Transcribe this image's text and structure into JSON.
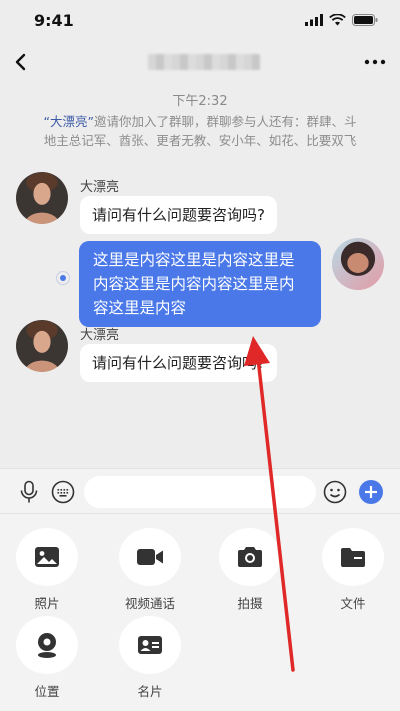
{
  "status_bar": {
    "time": "9:41"
  },
  "nav": {
    "back_label": "‹",
    "more_label": "···"
  },
  "chat": {
    "timestamp": "下午2:32",
    "system_message": {
      "inviter": "“大漂亮”",
      "text": "邀请你加入了群聊，群聊参与人还有：群肆、斗地主总记军、酋张、更者无教、安小年、如花、比要双飞"
    },
    "messages": [
      {
        "sender": "大漂亮",
        "text": "请问有什么问题要咨询吗?",
        "self": false
      },
      {
        "sender": "",
        "text": "这里是内容这里是内容这里是内容这里是内容内容这里是内容这里是内容",
        "self": true
      },
      {
        "sender": "大漂亮",
        "text": "请问有什么问题要咨询吗?",
        "self": false
      }
    ]
  },
  "input_bar": {
    "placeholder": ""
  },
  "tools": [
    {
      "label": "照片",
      "icon": "photo-icon"
    },
    {
      "label": "视频通话",
      "icon": "video-call-icon"
    },
    {
      "label": "拍摄",
      "icon": "camera-icon"
    },
    {
      "label": "文件",
      "icon": "file-icon"
    },
    {
      "label": "位置",
      "icon": "location-icon"
    },
    {
      "label": "名片",
      "icon": "contact-card-icon"
    }
  ],
  "colors": {
    "accent": "#4a78e8",
    "arrow": "#e02828"
  }
}
